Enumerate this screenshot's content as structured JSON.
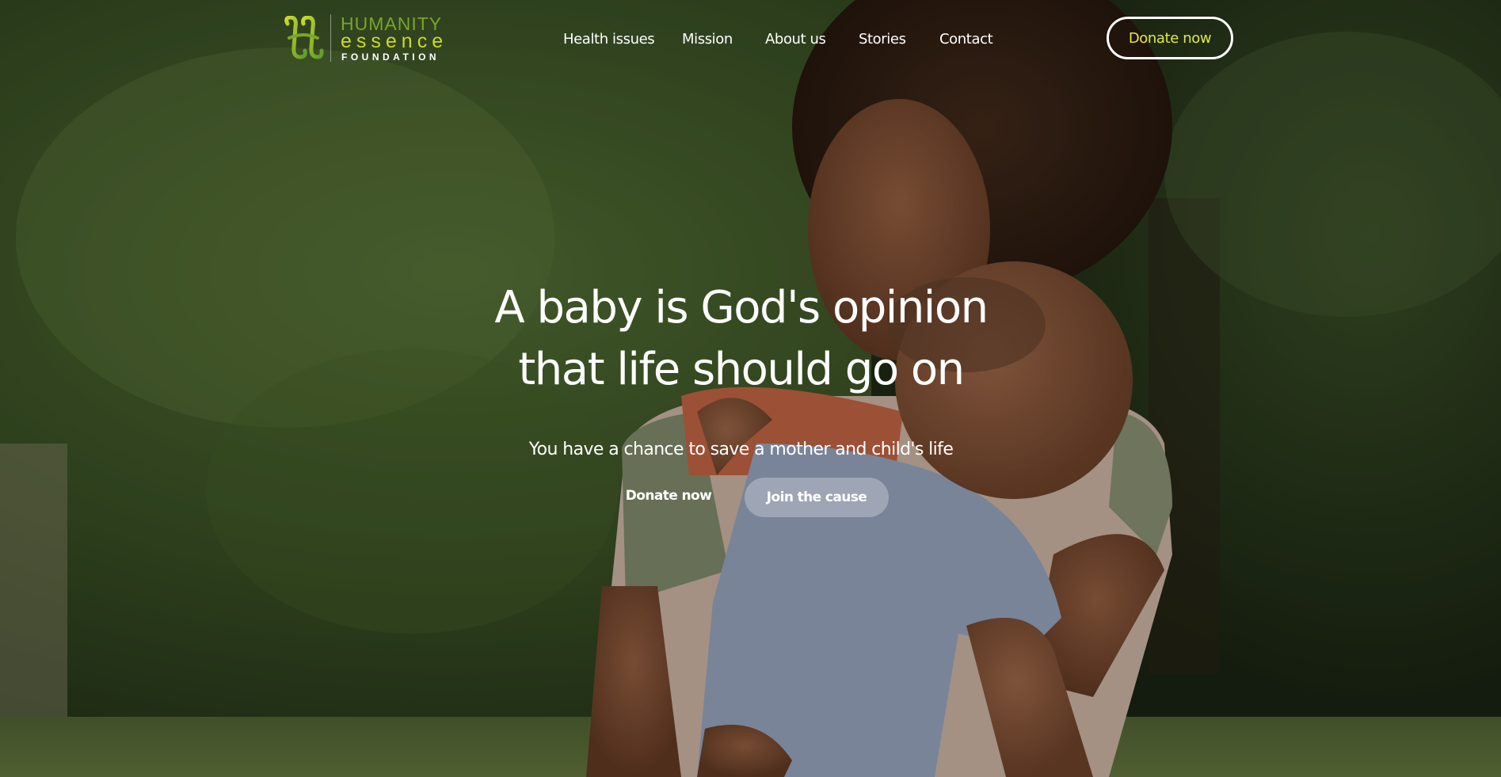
{
  "logo": {
    "line1": "HUMANITY",
    "line2": "essence",
    "line3": "FOUNDATION",
    "icon": "hands-logo-icon",
    "colors": {
      "green": "#7aa52a",
      "lime": "#c8dc2a"
    }
  },
  "nav": {
    "items": [
      {
        "label": "Health issues"
      },
      {
        "label": "Mission"
      },
      {
        "label": "About us"
      },
      {
        "label": "Stories"
      },
      {
        "label": "Contact"
      }
    ],
    "donate_label": "Donate now",
    "donate_color": "#dde94a"
  },
  "hero": {
    "headline_line1": "A baby is God's opinion",
    "headline_line2": "that life should go on",
    "subheadline": "You have a chance to save a mother and child's life",
    "primary_cta": "Donate now",
    "secondary_cta": "Join the cause",
    "background": "photo-mother-hugging-child-in-park"
  }
}
